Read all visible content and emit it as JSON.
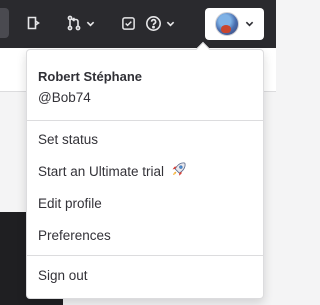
{
  "topbar": {
    "icons": [
      "merge-request-icon",
      "issues-icon",
      "chevron-down-icon",
      "todo-icon",
      "help-icon",
      "avatar",
      "chevron-down-icon"
    ]
  },
  "user_menu": {
    "name": "Robert Stéphane",
    "username": "@Bob74",
    "items": [
      {
        "label": "Set status"
      },
      {
        "label": "Start an Ultimate trial",
        "icon": "rocket-icon"
      },
      {
        "label": "Edit profile"
      },
      {
        "label": "Preferences"
      },
      {
        "label": "Sign out"
      }
    ]
  }
}
